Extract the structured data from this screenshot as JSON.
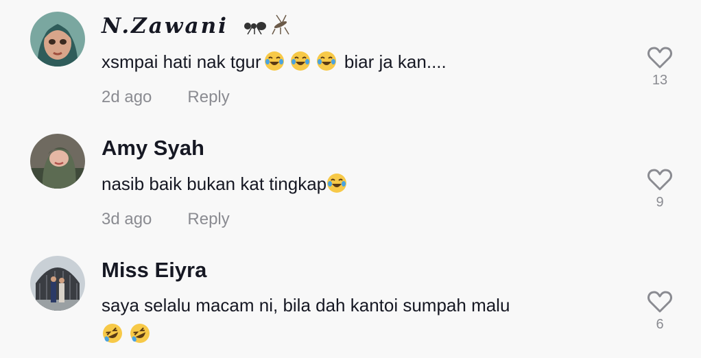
{
  "comments": [
    {
      "username": "N.Zawani",
      "text_before": "xsmpai hati nak tgur",
      "text_after": " biar ja kan....",
      "time": "2d ago",
      "reply_label": "Reply",
      "likes": "13",
      "avatar_icon": "avatar-cartoon-icon",
      "emojis": [
        "tears-of-joy-emoji",
        "tears-of-joy-emoji",
        "tears-of-joy-emoji"
      ]
    },
    {
      "username": "Amy Syah",
      "text_before": "nasib baik bukan kat tingkap",
      "time": "3d ago",
      "reply_label": "Reply",
      "likes": "9",
      "avatar_icon": "avatar-photo-icon",
      "emojis": [
        "tears-of-joy-emoji"
      ]
    },
    {
      "username": "Miss Eiyra",
      "text_before": "saya selalu macam ni, bila dah kantoi sumpah malu",
      "likes": "6",
      "avatar_icon": "avatar-photo-icon",
      "emojis": [
        "rolling-laughing-emoji",
        "rolling-laughing-emoji"
      ]
    }
  ],
  "colors": {
    "background": "#f8f8f8",
    "text": "#161823",
    "muted": "#8a8b91",
    "emoji_yellow": "#f7c948"
  }
}
